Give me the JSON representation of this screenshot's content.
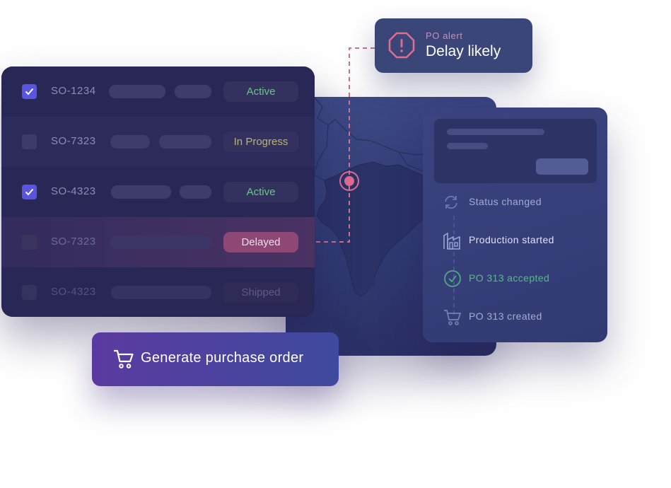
{
  "alert": {
    "title": "PO alert",
    "message": "Delay likely",
    "icon": "warning-octagon-icon",
    "accent_color": "#e06c8e"
  },
  "orders": [
    {
      "id": "SO-1234",
      "checked": true,
      "status": "Active",
      "status_color": "#6ec38c"
    },
    {
      "id": "SO-7323",
      "checked": false,
      "status": "In Progress",
      "status_color": "#b9b27a"
    },
    {
      "id": "SO-4323",
      "checked": true,
      "status": "Active",
      "status_color": "#6ec38c"
    },
    {
      "id": "SO-7323",
      "checked": false,
      "status": "Delayed",
      "status_color": "#8e4876"
    },
    {
      "id": "SO-4323",
      "checked": false,
      "status": "Shipped",
      "status_color": "#5d5b85"
    }
  ],
  "activity": {
    "items": [
      {
        "label": "Status changed",
        "icon": "refresh-icon"
      },
      {
        "label": "Production started",
        "icon": "factory-icon"
      },
      {
        "label": "PO 313 accepted",
        "icon": "check-circle-icon"
      },
      {
        "label": "PO 313 created",
        "icon": "cart-icon"
      }
    ]
  },
  "actions": {
    "generate_label": "Generate purchase order",
    "icon": "cart-icon"
  },
  "map": {
    "marker_icon": "location-pin-icon",
    "marker_color": "#e06c8e"
  }
}
